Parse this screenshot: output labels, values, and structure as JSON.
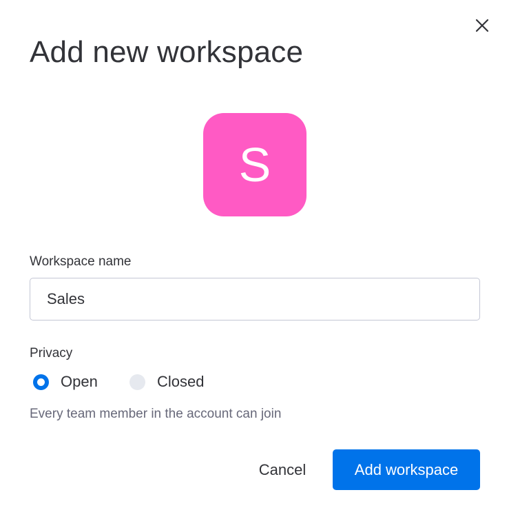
{
  "dialog": {
    "title": "Add new workspace",
    "close_icon": "close-icon"
  },
  "avatar": {
    "letter": "S",
    "color": "#ff5ac4"
  },
  "workspace_name": {
    "label": "Workspace name",
    "value": "Sales"
  },
  "privacy": {
    "label": "Privacy",
    "options": [
      {
        "label": "Open",
        "selected": true
      },
      {
        "label": "Closed",
        "selected": false
      }
    ],
    "description": "Every team member in the account can join"
  },
  "actions": {
    "cancel_label": "Cancel",
    "submit_label": "Add workspace",
    "submit_color": "#0073ea"
  }
}
